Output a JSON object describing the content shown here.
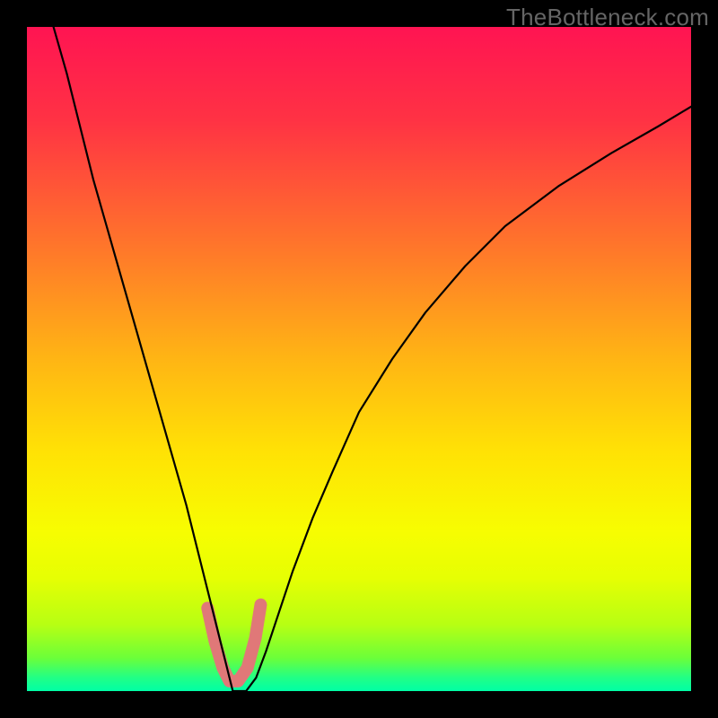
{
  "watermark": "TheBottleneck.com",
  "chart_data": {
    "type": "line",
    "title": "",
    "xlabel": "",
    "ylabel": "",
    "xlim": [
      0,
      100
    ],
    "ylim": [
      0,
      100
    ],
    "background_gradient": {
      "stops": [
        {
          "offset": 0,
          "color": "#ff1452"
        },
        {
          "offset": 0.14,
          "color": "#ff3244"
        },
        {
          "offset": 0.32,
          "color": "#ff722c"
        },
        {
          "offset": 0.5,
          "color": "#ffb514"
        },
        {
          "offset": 0.64,
          "color": "#ffe205"
        },
        {
          "offset": 0.76,
          "color": "#f7fd01"
        },
        {
          "offset": 0.83,
          "color": "#e6ff03"
        },
        {
          "offset": 0.9,
          "color": "#b7ff13"
        },
        {
          "offset": 0.95,
          "color": "#6cff39"
        },
        {
          "offset": 0.98,
          "color": "#21ff86"
        },
        {
          "offset": 1.0,
          "color": "#00ffa6"
        }
      ]
    },
    "series": [
      {
        "name": "bottleneck-curve",
        "color": "#000000",
        "width": 2.2,
        "x": [
          4,
          6,
          8,
          10,
          12,
          14,
          16,
          18,
          20,
          22,
          24,
          26,
          27,
          28,
          29,
          30,
          30.5,
          31,
          32,
          33,
          34.5,
          36,
          38,
          40,
          43,
          46,
          50,
          55,
          60,
          66,
          72,
          80,
          88,
          95,
          100
        ],
        "y": [
          100,
          93,
          85,
          77,
          70,
          63,
          56,
          49,
          42,
          35,
          28,
          20,
          16,
          12,
          8,
          4,
          2,
          0,
          0,
          0,
          2,
          6,
          12,
          18,
          26,
          33,
          42,
          50,
          57,
          64,
          70,
          76,
          81,
          85,
          88
        ]
      }
    ],
    "annotations": [
      {
        "name": "floor-highlight",
        "type": "polyline",
        "color": "#e07878",
        "width": 14,
        "linecap": "round",
        "points_x": [
          27.2,
          28.3,
          29.5,
          30.5,
          31.8,
          33.2,
          34.4,
          35.2
        ],
        "points_y": [
          12.5,
          7.5,
          3.5,
          1.5,
          1.5,
          3.5,
          8.0,
          13.0
        ]
      }
    ]
  }
}
